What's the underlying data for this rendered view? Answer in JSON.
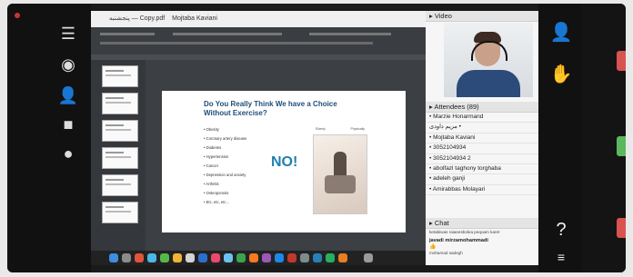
{
  "share": {
    "title": "‏پنجشنبه — Copy.pdf",
    "owner": "Mojtaba Kaviani"
  },
  "slide": {
    "title": "Do You Really Think We have a Choice Without Exercise?",
    "bullets": [
      "Obesity",
      "Coronary artery disease",
      "Diabetes",
      "Hypertension",
      "Cancer",
      "Depression and anxiety",
      "Arthritis",
      "Osteoporosis",
      "Etc, etc, etc…"
    ],
    "big_word": "NO!",
    "photo_caption_left": "Elderly",
    "photo_caption_right": "Physically"
  },
  "video": {
    "header": "Video"
  },
  "attendees": {
    "header": "Attendees (89)",
    "list": [
      "Marzie Honarmand",
      "مریم داودی",
      "Mojtaba Kaviani",
      "3052104934",
      "3052104934 2",
      "abolfazl taghony torghaba",
      "adeleh ganji",
      "Amirabbas Molayari"
    ]
  },
  "chat": {
    "header": "Chat",
    "preview": "ketabiwas raiaeesbolea peqoam karet",
    "sender": "javadi mirzamohammadi",
    "emoji": "👍",
    "next_sender": "mohamad sadegh"
  },
  "icons": {
    "left": [
      "grid-icon",
      "record-icon",
      "participants-icon",
      "camera-icon",
      "chat-icon"
    ],
    "right": [
      "user-icon",
      "raise-hand-icon",
      "help-icon",
      "menu-icon"
    ]
  },
  "colors": {
    "accent": "#1f7fb0",
    "record": "#c33333",
    "slide_title": "#1f4e79"
  }
}
